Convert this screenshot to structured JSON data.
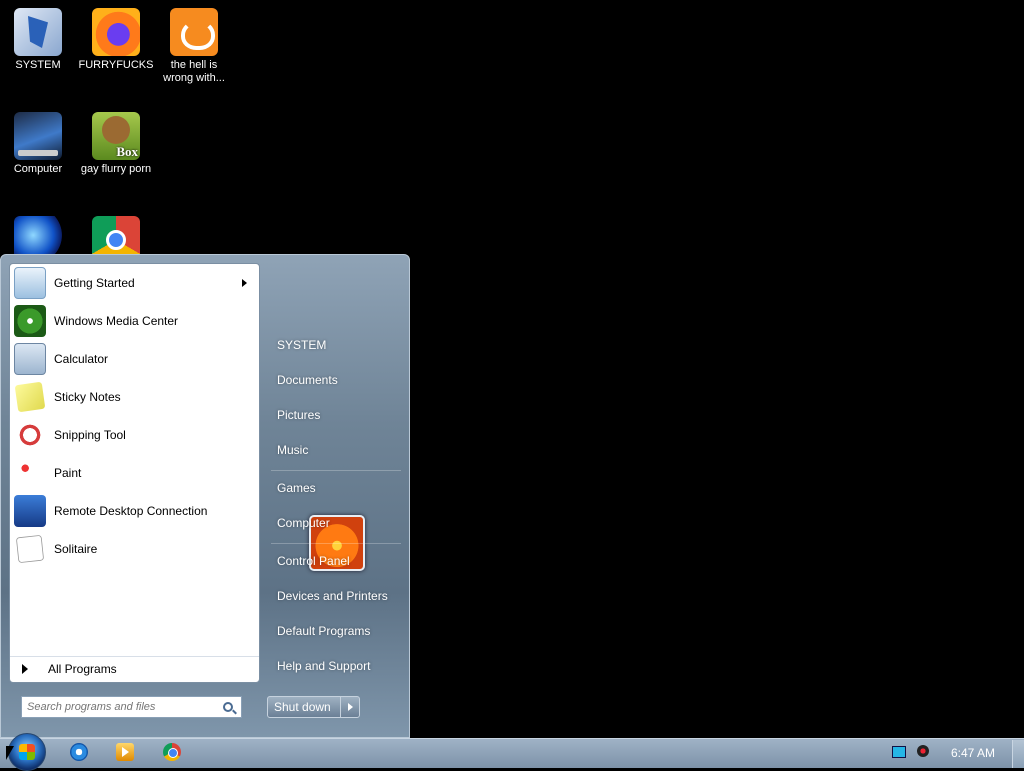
{
  "desktop": {
    "icons": [
      {
        "label": "SYSTEM"
      },
      {
        "label": "FURRYFUCKS"
      },
      {
        "label": "the hell is wrong with..."
      },
      {
        "label": "Computer"
      },
      {
        "label": "gay flurry porn"
      },
      {
        "label": ""
      },
      {
        "label": ""
      }
    ]
  },
  "start_menu": {
    "programs": [
      {
        "label": "Getting Started",
        "has_submenu": true
      },
      {
        "label": "Windows Media Center"
      },
      {
        "label": "Calculator"
      },
      {
        "label": "Sticky Notes"
      },
      {
        "label": "Snipping Tool"
      },
      {
        "label": "Paint"
      },
      {
        "label": "Remote Desktop Connection"
      },
      {
        "label": "Solitaire"
      }
    ],
    "all_programs": "All Programs",
    "search_placeholder": "Search programs and files",
    "right_links": [
      "SYSTEM",
      "Documents",
      "Pictures",
      "Music",
      "Games",
      "Computer",
      "Control Panel",
      "Devices and Printers",
      "Default Programs",
      "Help and Support"
    ],
    "shutdown_label": "Shut down"
  },
  "taskbar": {
    "pinned": [
      "ie-icon",
      "media-player-icon",
      "chrome-icon"
    ],
    "clock": "6:47 AM"
  }
}
